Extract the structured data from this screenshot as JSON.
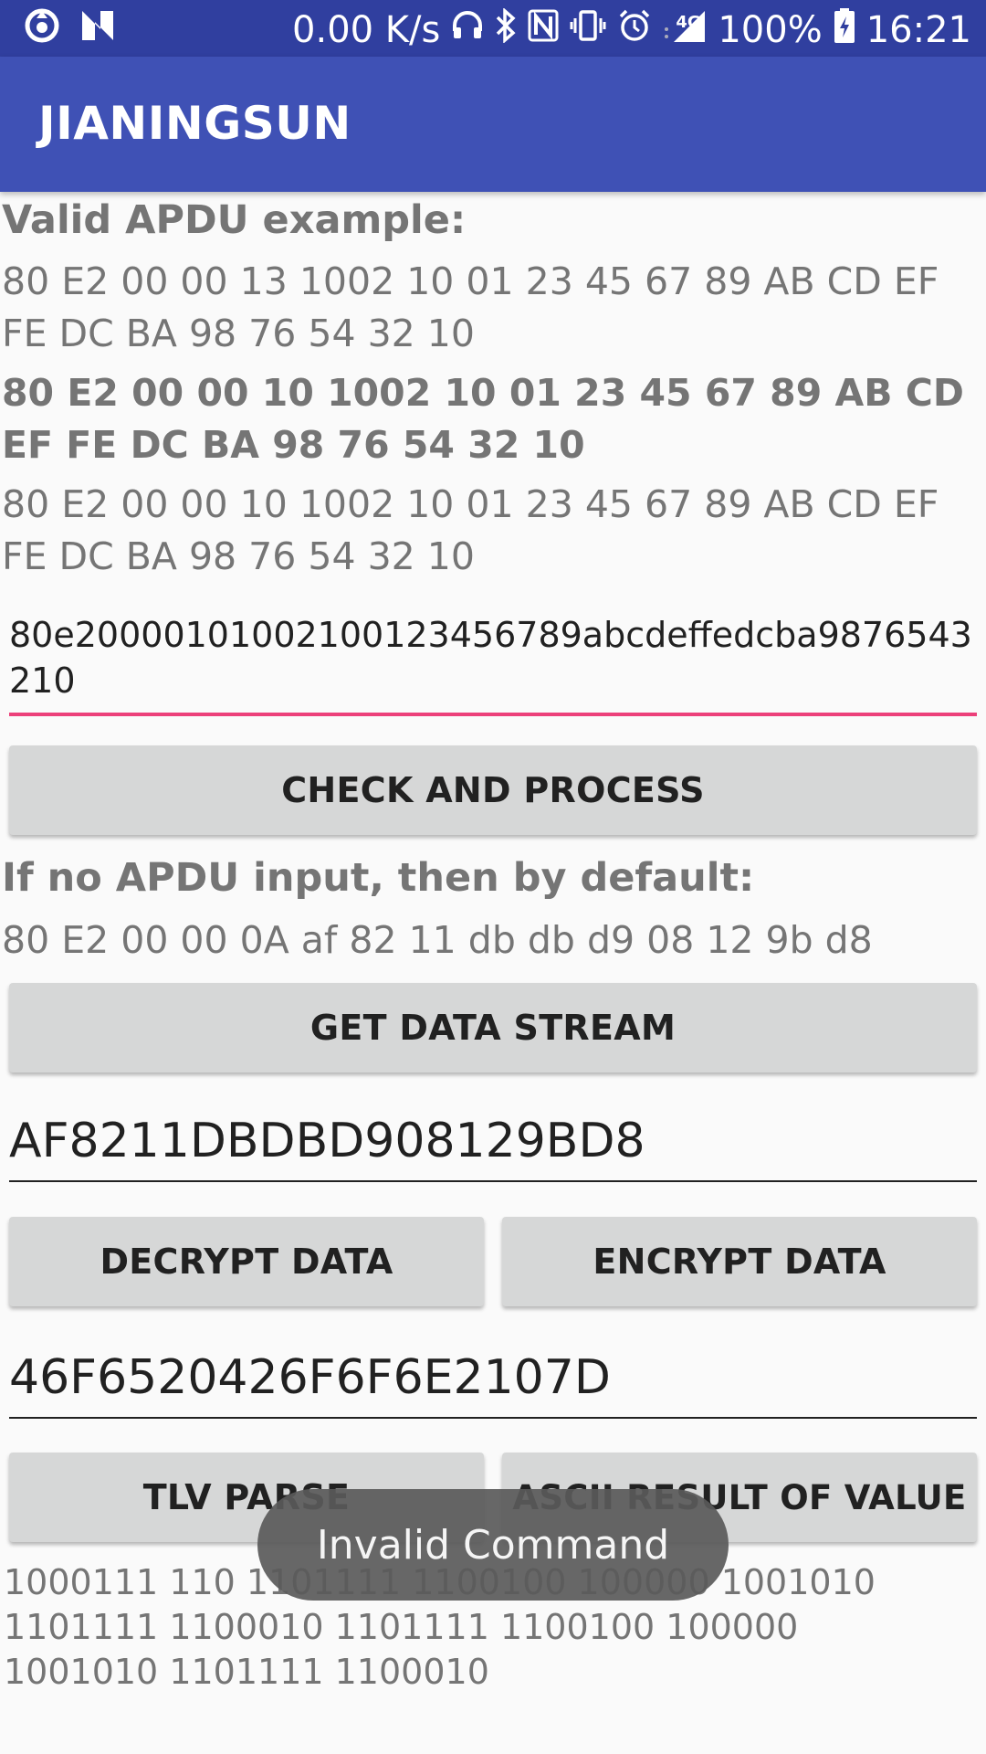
{
  "status_bar": {
    "left_icons": [
      "gear-sync-icon",
      "n-logo-icon"
    ],
    "network_speed": "0.00 K/s",
    "right_icons": [
      "headphones-icon",
      "bluetooth-icon",
      "nfc-icon",
      "vibrate-icon",
      "alarm-icon",
      "signal-4g-icon"
    ],
    "network_type": "4G",
    "battery": "100%",
    "time": "16:21"
  },
  "app_bar": {
    "title": "JIANINGSUN"
  },
  "examples": {
    "heading": "Valid APDU example:",
    "line1": "80 E2 00 00 13 1002 10 01 23 45 67 89 AB CD EF FE DC BA 98 76 54 32 10",
    "line2": "80 E2 00 00 10 1002 10 01 23 45 67 89 AB CD EF FE DC BA 98 76 54 32 10",
    "line3": "80 E2 00 00 10 1002 10 01 23 45 67 89 AB CD EF FE DC BA 98 76 54 32 10"
  },
  "apdu_input": {
    "value": "80e20000101002100123456789abcdeffedcba9876543210"
  },
  "check_button": {
    "label": "CHECK AND PROCESS"
  },
  "default_info": {
    "heading": "If no APDU input, then by default:",
    "value": "80 E2 00 00 0A af 82 11 db db d9 08 12 9b d8"
  },
  "get_stream_button": {
    "label": "GET DATA STREAM"
  },
  "data_stream_field": {
    "value": "AF8211DBDBD908129BD8"
  },
  "decrypt_button": {
    "label": "DECRYPT DATA"
  },
  "encrypt_button": {
    "label": "ENCRYPT DATA"
  },
  "result_field": {
    "value": "46F6520426F6F6E2107D"
  },
  "tlv_button": {
    "label": "TLV PARSE"
  },
  "ascii_button": {
    "label": "ASCII RESULT OF VALUE"
  },
  "binary_output": {
    "text": "1000111 110 1101111 1100100 100000 1001010 1101111 1100010  1101111 1100100 100000 1001010 1101111 1100010"
  },
  "toast": {
    "message": "Invalid Command"
  },
  "colors": {
    "status_bar": "#303f9f",
    "app_bar": "#3f51b5",
    "accent": "#ec407a",
    "button": "#d6d7d7"
  }
}
